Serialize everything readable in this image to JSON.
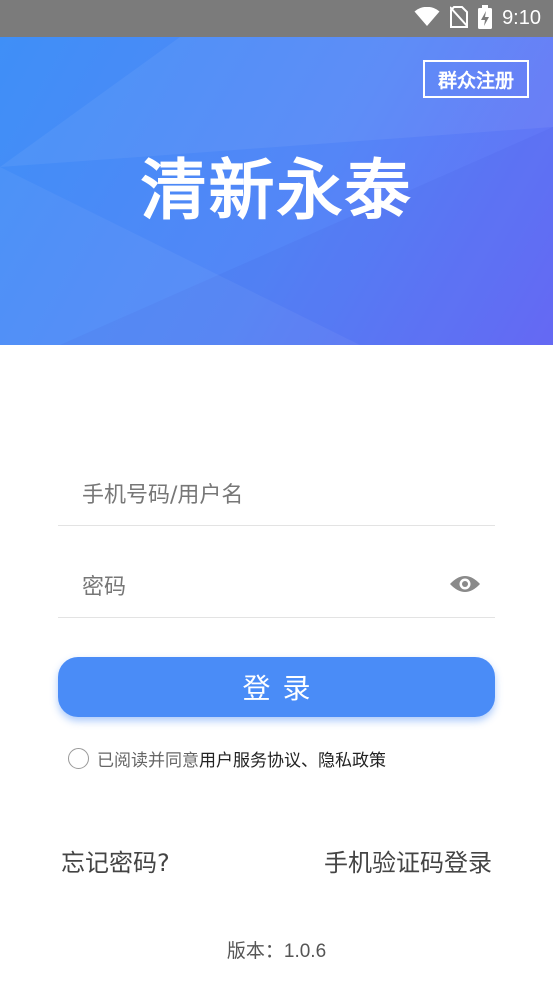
{
  "status_bar": {
    "time": "9:10",
    "icons": [
      "wifi-icon",
      "no-sim-icon",
      "battery-charging-icon"
    ]
  },
  "header": {
    "register_label": "群众注册",
    "app_title": "清新永泰"
  },
  "login_form": {
    "username_placeholder": "手机号码/用户名",
    "password_placeholder": "密码",
    "password_toggle_icon": "eye-icon",
    "login_label": "登录"
  },
  "agreement": {
    "prefix": "已阅读并同意 ",
    "links": "用户服务协议、隐私政策",
    "checked": false
  },
  "links": {
    "forgot_password": "忘记密码?",
    "sms_login": "手机验证码登录"
  },
  "version": {
    "label": "版本：",
    "number": "1.0.6"
  },
  "colors": {
    "primary": "#4a8cf7",
    "hero_start": "#3f8ff7",
    "hero_end": "#6a6cf6",
    "status_bar": "#7b7b7b"
  }
}
